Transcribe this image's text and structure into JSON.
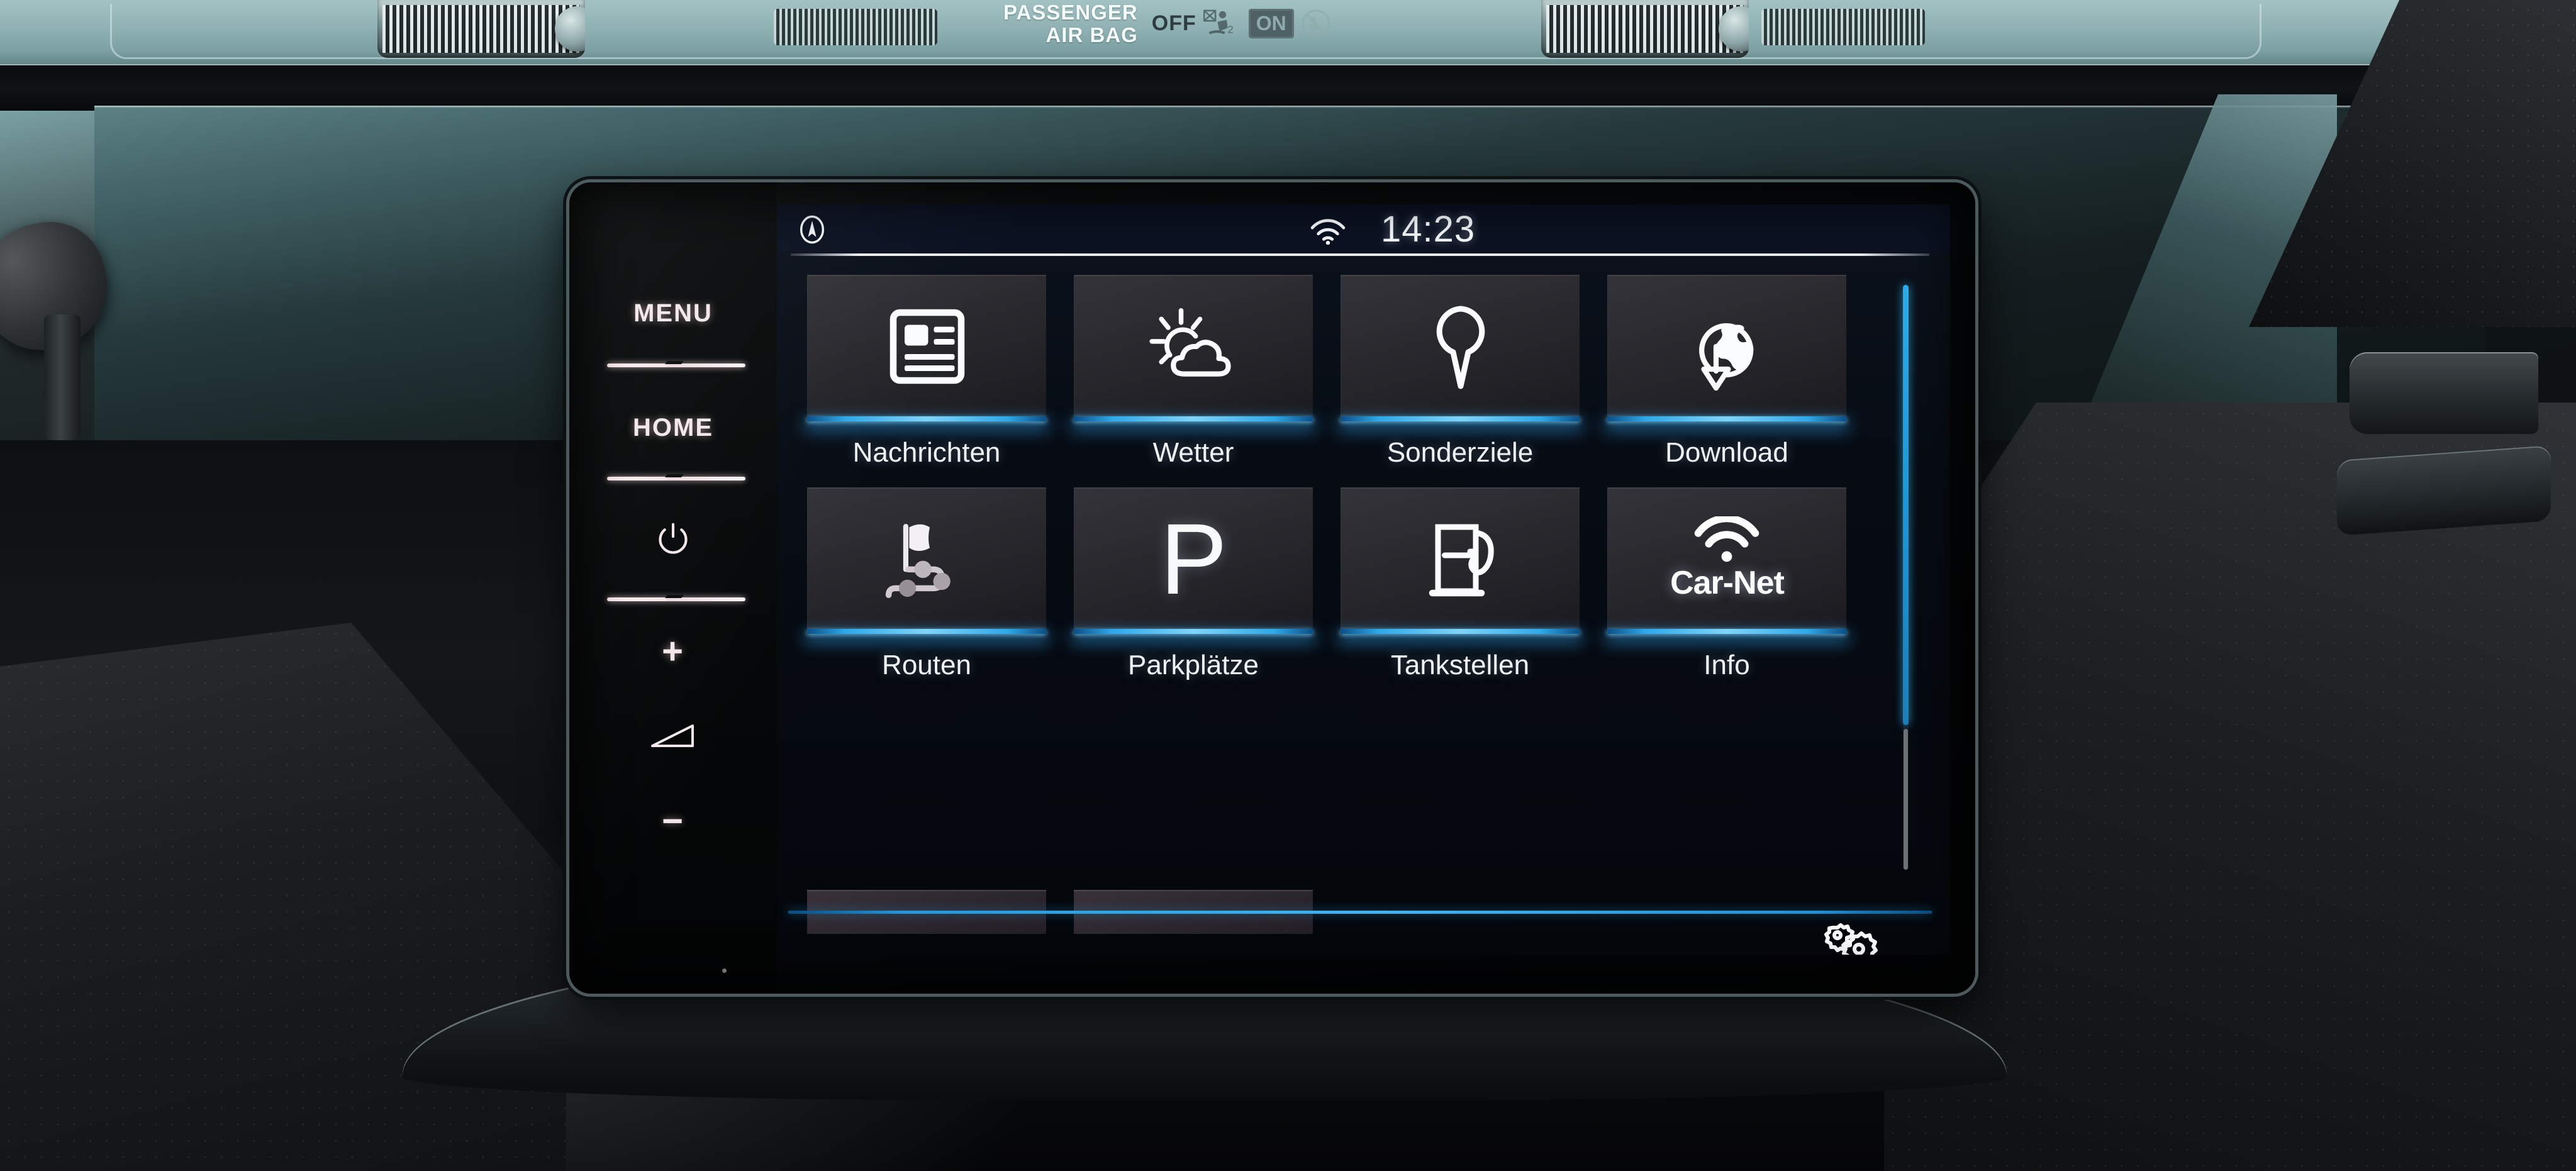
{
  "vehicle": {
    "airbag_indicator": {
      "title_line1": "PASSENGER",
      "title_line2": "AIR BAG",
      "off_label": "OFF",
      "on_label": "ON",
      "off_glyph": "airbag-off-icon",
      "on_glyph": "airbag-disabled-icon"
    }
  },
  "head_unit": {
    "hardware_keys": [
      {
        "label": "MENU",
        "name": "menu-key",
        "type": "text"
      },
      {
        "label": "HOME",
        "name": "home-key",
        "type": "text"
      },
      {
        "label": "",
        "name": "power-key",
        "type": "icon",
        "icon": "power-icon"
      },
      {
        "label": "+",
        "name": "volume-up-key",
        "type": "text"
      },
      {
        "label": "",
        "name": "volume-level-indicator",
        "type": "icon",
        "icon": "volume-wedge-icon"
      },
      {
        "label": "−",
        "name": "volume-down-key",
        "type": "text"
      }
    ],
    "status_bar": {
      "navigation_icon": "compass-icon",
      "wifi_icon": "wifi-icon",
      "clock": "14:23"
    },
    "screen": {
      "title": "",
      "tiles": [
        {
          "label": "Nachrichten",
          "icon": "news-article-icon",
          "accent": "#2ea8e8"
        },
        {
          "label": "Wetter",
          "icon": "sun-behind-cloud-icon",
          "accent": "#2ea8e8"
        },
        {
          "label": "Sonderziele",
          "icon": "map-pin-icon",
          "accent": "#2ea8e8"
        },
        {
          "label": "Download",
          "icon": "globe-download-icon",
          "accent": "#2ea8e8"
        },
        {
          "label": "Routen",
          "icon": "route-flag-icon",
          "accent": "#2ea8e8"
        },
        {
          "label": "Parkplätze",
          "icon": "parking-p-glyph",
          "accent": "#2ea8e8",
          "glyph": "P"
        },
        {
          "label": "Tankstellen",
          "icon": "fuel-pump-icon",
          "accent": "#2ea8e8"
        },
        {
          "label": "Info",
          "icon": "car-net-wifi-icon",
          "accent": "#2ea8e8",
          "wordmark": "Car-Net"
        }
      ],
      "partial_row_tiles": 2,
      "scrollbar": {
        "thumb_fraction": 0.75,
        "position": "top"
      },
      "settings_button": {
        "icon": "double-gear-icon",
        "label": ""
      }
    },
    "colors": {
      "accent_blue": "#2ea8e8",
      "tile_face": "#2b2a2f",
      "lcd_background": "#070c14",
      "status_bar": "#0a1120",
      "text_primary": "#f0f4f8",
      "key_backlight": "#f3e7e9"
    }
  }
}
